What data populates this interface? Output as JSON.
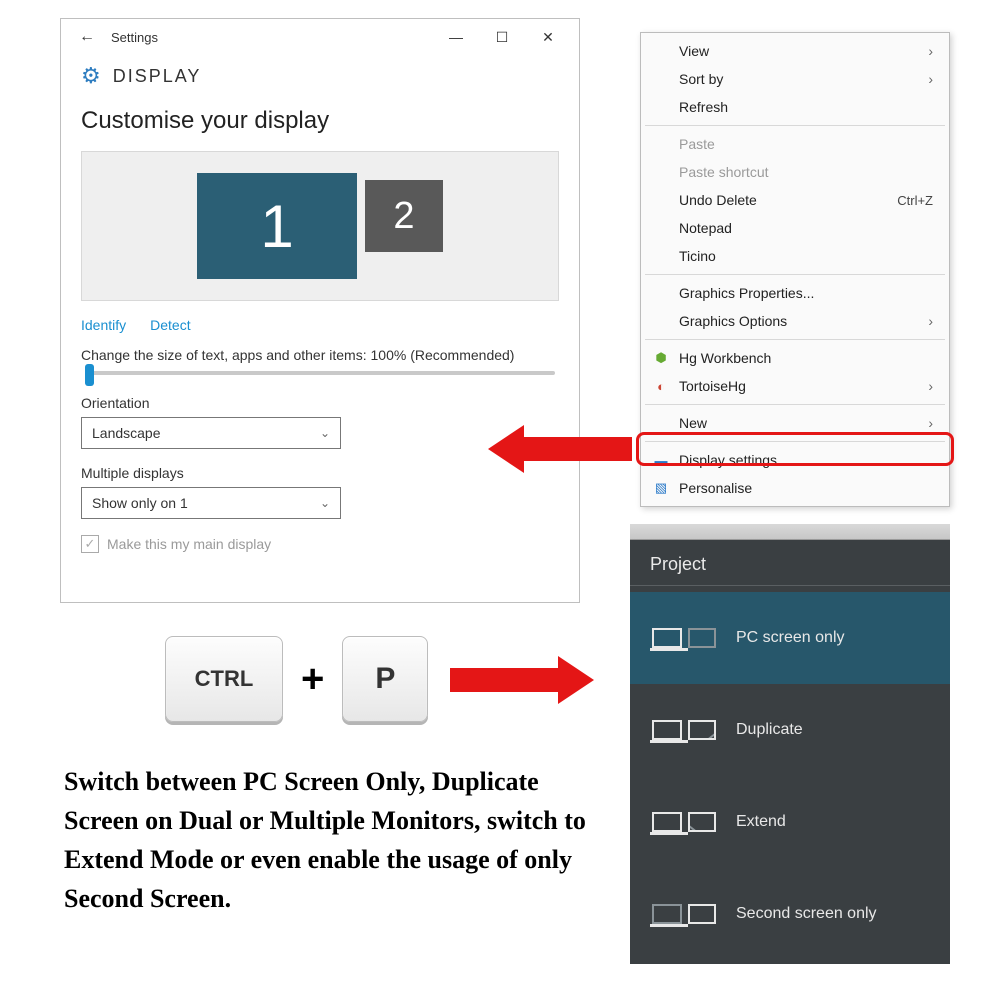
{
  "settings": {
    "window_title": "Settings",
    "header": "DISPLAY",
    "section_title": "Customise your display",
    "monitor_primary": "1",
    "monitor_secondary": "2",
    "identify": "Identify",
    "detect": "Detect",
    "scale_label": "Change the size of text, apps and other items: 100% (Recommended)",
    "orientation_label": "Orientation",
    "orientation_value": "Landscape",
    "multiple_label": "Multiple displays",
    "multiple_value": "Show only on 1",
    "main_display_label": "Make this my main display"
  },
  "context_menu": {
    "view": "View",
    "sort_by": "Sort by",
    "refresh": "Refresh",
    "paste": "Paste",
    "paste_shortcut": "Paste shortcut",
    "undo_delete": "Undo Delete",
    "undo_shortcut": "Ctrl+Z",
    "notepad": "Notepad",
    "ticino": "Ticino",
    "graphics_props": "Graphics Properties...",
    "graphics_opts": "Graphics Options",
    "hg_workbench": "Hg Workbench",
    "tortoise": "TortoiseHg",
    "new_item": "New",
    "display_settings": "Display settings",
    "personalise": "Personalise"
  },
  "keys": {
    "ctrl": "CTRL",
    "plus": "+",
    "p": "P"
  },
  "project": {
    "title": "Project",
    "pc_only": "PC screen only",
    "duplicate": "Duplicate",
    "extend": "Extend",
    "second_only": "Second screen only"
  },
  "caption": "Switch between PC Screen Only, Duplicate Screen on Dual or Multiple Monitors, switch to Extend Mode or even enable the usage of only Second Screen."
}
